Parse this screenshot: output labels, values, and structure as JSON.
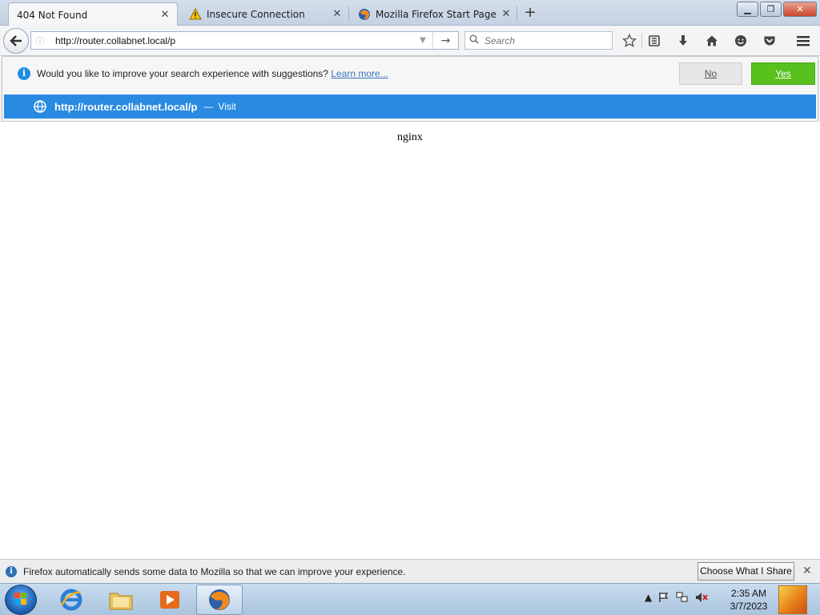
{
  "tabs": [
    {
      "title": "404 Not Found",
      "active": true
    },
    {
      "title": "Insecure Connection",
      "active": false
    },
    {
      "title": "Mozilla Firefox Start Page",
      "active": false
    }
  ],
  "new_tab": "+",
  "window_buttons": {
    "minimize": "▁",
    "maximize": "❐",
    "close": "✕"
  },
  "navbar": {
    "url_value": "http://router.collabnet.local/p",
    "url_go": "→",
    "url_drop": "▼",
    "search_placeholder": "Search"
  },
  "toolbar_icons": [
    "bookmark-star-icon",
    "reading-list-icon",
    "downloads-icon",
    "home-icon",
    "hello-icon",
    "pocket-icon",
    "menu-icon"
  ],
  "suggestion_prompt": {
    "message": "Would you like to improve your search experience with suggestions?",
    "learn_more": "Learn more...",
    "no_label": "No",
    "yes_label": "Yes"
  },
  "visit_row": {
    "url": "http://router.collabnet.local/p",
    "dash": "—",
    "visit_label": "Visit"
  },
  "page": {
    "body_text": "nginx"
  },
  "data_notification": {
    "message": "Firefox automatically sends some data to Mozilla so that we can improve your experience.",
    "button_label": "Choose What I Share",
    "close": "✕"
  },
  "taskbar": {
    "apps": [
      "internet-explorer",
      "file-explorer",
      "media-player",
      "firefox"
    ],
    "time": "2:35 AM",
    "date": "3/7/2023"
  },
  "colors": {
    "accent_blue": "#2a8ae1",
    "yes_green": "#58c11e"
  }
}
